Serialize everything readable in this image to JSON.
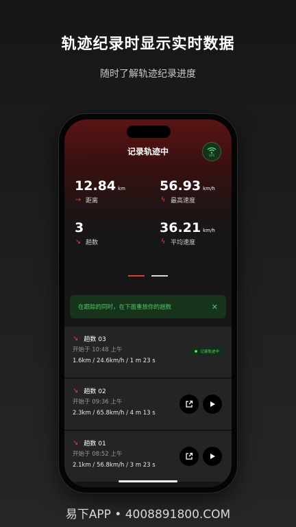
{
  "promo": {
    "headline": "轨迹纪录时显示实时数据",
    "subline": "随时了解轨迹纪录进度"
  },
  "app": {
    "title": "记录轨迹中",
    "gps_label": "GPS",
    "stats": [
      {
        "value": "12.84",
        "unit": "km",
        "label": "距离",
        "icon": "arrow-right-icon"
      },
      {
        "value": "56.93",
        "unit": "km/h",
        "label": "最高速度",
        "icon": "lightning-icon"
      },
      {
        "value": "3",
        "unit": "",
        "label": "趟数",
        "icon": "arrow-down-right-icon"
      },
      {
        "value": "36.21",
        "unit": "km/h",
        "label": "平均速度",
        "icon": "lightning-icon"
      }
    ],
    "pager": {
      "pages": 2,
      "active": 1
    },
    "toast": {
      "text": "在跟踪的同时，在下面重放你的趟数",
      "close": "✕"
    },
    "trips": [
      {
        "title": "趟数 03",
        "start": "开始于 10:48 上午",
        "summary": "1.6km  /  24.6km/h  /  1 m 23 s",
        "status": "记录轨迹中",
        "recording": true
      },
      {
        "title": "趟数 02",
        "start": "开始于 09:36 上午",
        "summary": "2.3km  /  65.8km/h  /  4 m 13 s",
        "recording": false
      },
      {
        "title": "趟数 01",
        "start": "开始于 08:52 上午",
        "summary": "2.1km  /  56.8km/h  /  3 m 23 s",
        "recording": false
      }
    ],
    "colors": {
      "accent": "#e5453a",
      "success": "#4fcb62"
    }
  },
  "footer": {
    "text": "易下APP • 4008891800.COM"
  }
}
